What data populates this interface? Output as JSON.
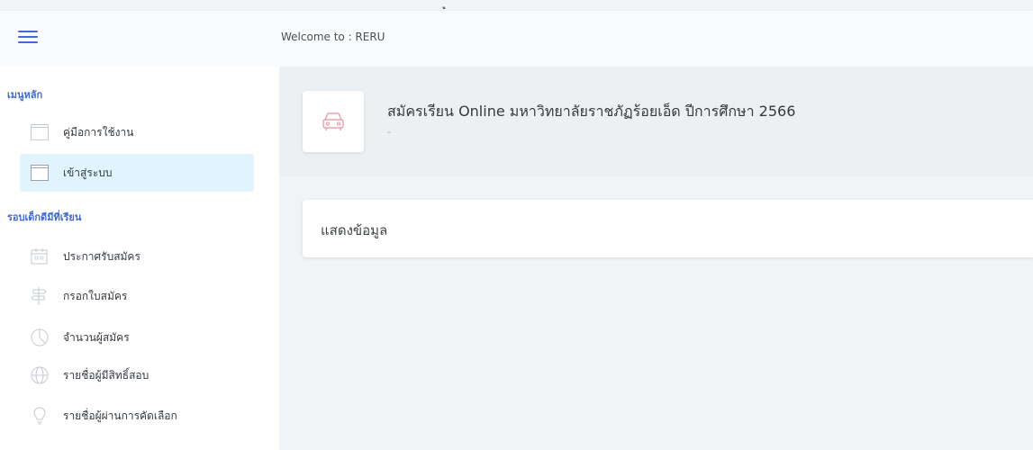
{
  "stray_glyph": "ู",
  "header": {
    "welcome_text": "Welcome to : RERU"
  },
  "sidebar": {
    "section_main": {
      "heading": "เมนูหลัก",
      "items": [
        {
          "label": "คู่มือการใช้งาน",
          "icon": "box-icon",
          "active": false
        },
        {
          "label": "เข้าสู่ระบบ",
          "icon": "box-icon",
          "active": true
        }
      ]
    },
    "section_round": {
      "heading": "รอบเด็กดีมีที่เรียน",
      "items": [
        {
          "label": "ประกาศรับสมัคร",
          "icon": "calendar-icon"
        },
        {
          "label": "กรอกใบสมัคร",
          "icon": "signpost-icon"
        },
        {
          "label": "จำนวนผู้สมัคร",
          "icon": "pie-chart-icon"
        },
        {
          "label": "รายชื่อผู้มีสิทธิ์สอบ",
          "icon": "globe-icon"
        },
        {
          "label": "รายชื่อผู้ผ่านการคัดเลือก",
          "icon": "lightbulb-icon"
        }
      ]
    }
  },
  "main": {
    "title": "สมัครเรียน Online มหาวิทยาลัยราชภัฏร้อยเอ็ด ปีการศึกษา 2566",
    "subtitle": "-",
    "title_icon": "car-icon",
    "card_header": "แสดงข้อมูล"
  },
  "colors": {
    "accent": "#3f6ad8",
    "active_item_bg": "#e0f3ff",
    "title_icon": "#f08ca0"
  }
}
